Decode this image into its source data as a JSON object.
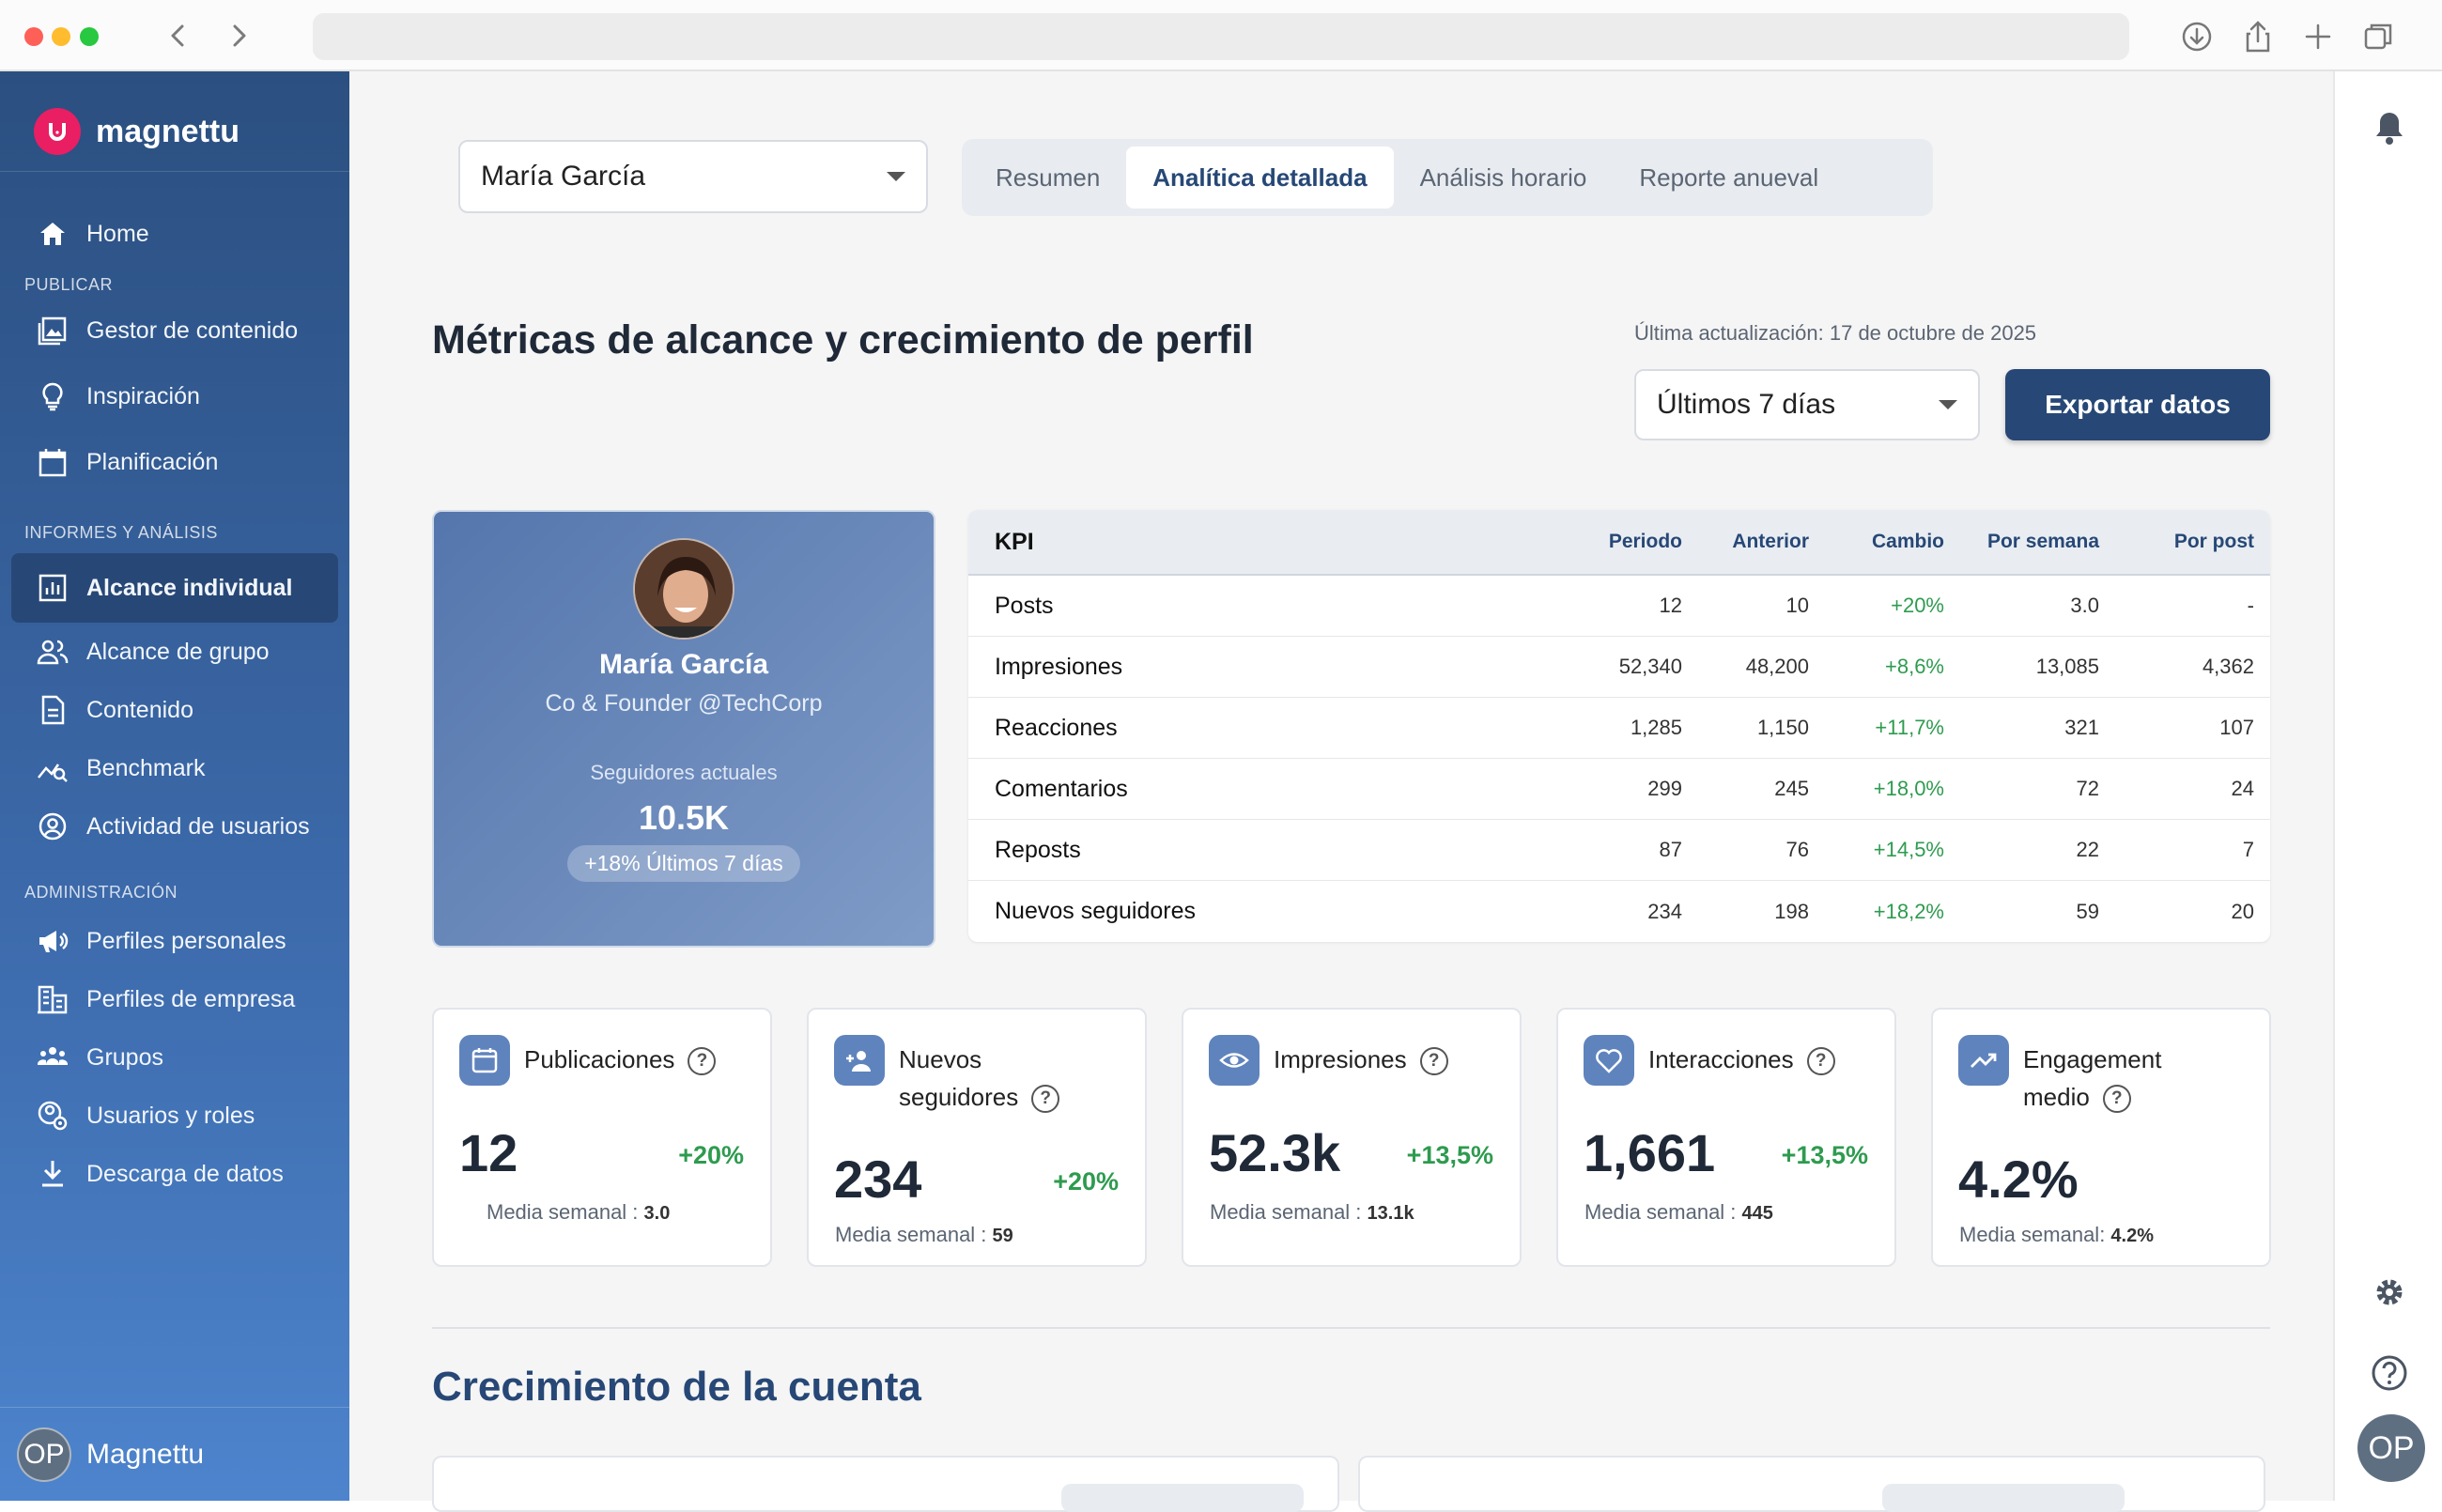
{
  "brand": {
    "name": "magnettu",
    "color": "#e91e63"
  },
  "sidebar": {
    "home": "Home",
    "sections": {
      "publicar": "PUBLICAR",
      "informes": "INFORMES Y ANÁLISIS",
      "admin": "ADMINISTRACIÓN"
    },
    "items": [
      {
        "label": "Gestor de contenido",
        "icon": "image-gallery-icon"
      },
      {
        "label": "Inspiración",
        "icon": "lightbulb-icon"
      },
      {
        "label": "Planificación",
        "icon": "calendar-icon"
      },
      {
        "label": "Alcance individual",
        "icon": "bar-chart-icon",
        "active": true
      },
      {
        "label": "Alcance de grupo",
        "icon": "users-icon"
      },
      {
        "label": "Contenido",
        "icon": "document-icon"
      },
      {
        "label": "Benchmark",
        "icon": "benchmark-icon"
      },
      {
        "label": "Actividad de usuarios",
        "icon": "user-circle-icon"
      },
      {
        "label": "Perfiles personales",
        "icon": "megaphone-icon"
      },
      {
        "label": "Perfiles de empresa",
        "icon": "building-icon"
      },
      {
        "label": "Grupos",
        "icon": "group-icon"
      },
      {
        "label": "Usuarios y roles",
        "icon": "user-settings-icon"
      },
      {
        "label": "Descarga de datos",
        "icon": "download-icon"
      }
    ],
    "footer": {
      "initials": "OP",
      "name": "Magnettu"
    }
  },
  "profile_select": {
    "value": "María García"
  },
  "tabs": [
    {
      "label": "Resumen"
    },
    {
      "label": "Analítica detallada",
      "active": true
    },
    {
      "label": "Análisis horario"
    },
    {
      "label": "Reporte anueval"
    }
  ],
  "page": {
    "title": "Métricas de alcance y crecimiento de perfil",
    "updated": "Última actualización: 17 de octubre de 2025",
    "period": "Últimos 7 días",
    "export": "Exportar datos"
  },
  "profile": {
    "name": "María García",
    "role": "Co & Founder @TechCorp",
    "followers_label": "Seguidores actuales",
    "followers": "10.5K",
    "badge": "+18% Últimos 7 días"
  },
  "kpi_table": {
    "headers": [
      "KPI",
      "Periodo",
      "Anterior",
      "Cambio",
      "Por semana",
      "Por post"
    ],
    "rows": [
      [
        "Posts",
        "12",
        "10",
        "+20%",
        "3.0",
        "-"
      ],
      [
        "Impresiones",
        "52,340",
        "48,200",
        "+8,6%",
        "13,085",
        "4,362"
      ],
      [
        "Reacciones",
        "1,285",
        "1,150",
        "+11,7%",
        "321",
        "107"
      ],
      [
        "Comentarios",
        "299",
        "245",
        "+18,0%",
        "72",
        "24"
      ],
      [
        "Reposts",
        "87",
        "76",
        "+14,5%",
        "22",
        "7"
      ],
      [
        "Nuevos seguidores",
        "234",
        "198",
        "+18,2%",
        "59",
        "20"
      ]
    ]
  },
  "cards": [
    {
      "label": "Publicaciones",
      "value": "12",
      "change": "+20%",
      "sub": "Media semanal : ",
      "sub_val": "3.0",
      "icon": "calendar-icon"
    },
    {
      "label": "Nuevos seguidores",
      "value": "234",
      "change": "+20%",
      "sub": "Media semanal : ",
      "sub_val": "59",
      "icon": "add-user-icon"
    },
    {
      "label": "Impresiones",
      "value": "52.3k",
      "change": "+13,5%",
      "sub": "Media semanal : ",
      "sub_val": "13.1k",
      "icon": "eye-icon"
    },
    {
      "label": "Interacciones",
      "value": "1,661",
      "change": "+13,5%",
      "sub": "Media semanal : ",
      "sub_val": "445",
      "icon": "heart-icon"
    },
    {
      "label": "Engagement medio",
      "value": "4.2%",
      "change": "",
      "sub": "Media semanal: ",
      "sub_val": "4.2%",
      "icon": "trending-up-icon"
    }
  ],
  "section2": {
    "title": "Crecimiento de la cuenta"
  },
  "rightrail": {
    "initials": "OP"
  },
  "colors": {
    "primary": "#274876",
    "positive": "#2e9b4f",
    "accent": "#e91e63"
  }
}
